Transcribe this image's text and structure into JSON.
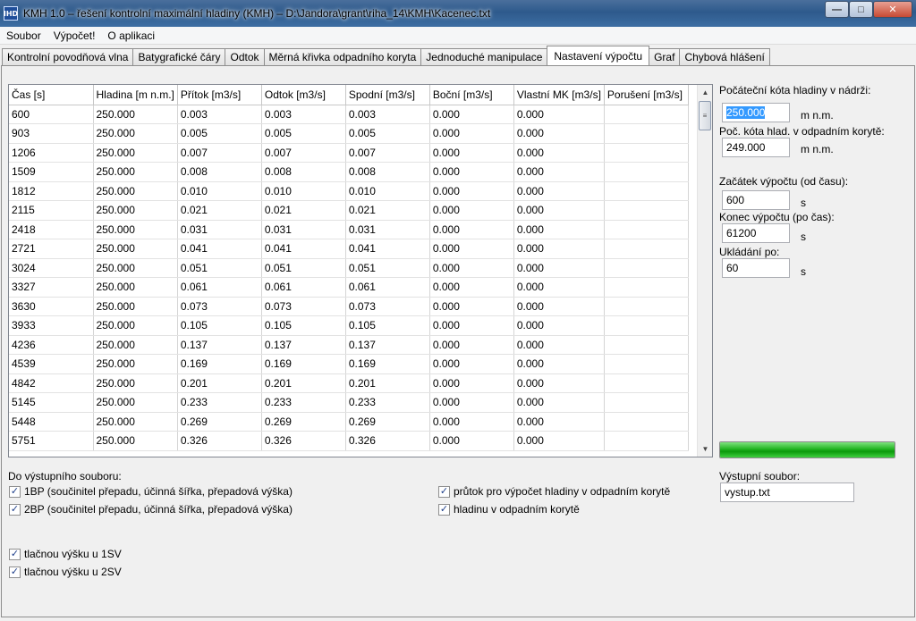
{
  "window": {
    "title": "KMH 1.0 – řešení kontrolní maximální hladiny (KMH) – D:\\Jandora\\grant\\riha_14\\KMH\\Kacenec.txt",
    "app_icon_text": "IHD"
  },
  "menu": [
    "Soubor",
    "Výpočet!",
    "O aplikaci"
  ],
  "tabs": [
    {
      "label": "Kontrolní povodňová vlna",
      "active": false
    },
    {
      "label": "Batygrafické čáry",
      "active": false
    },
    {
      "label": "Odtok",
      "active": false
    },
    {
      "label": "Měrná křivka odpadního koryta",
      "active": false
    },
    {
      "label": "Jednoduché manipulace",
      "active": false
    },
    {
      "label": "Nastavení výpočtu",
      "active": true
    },
    {
      "label": "Graf",
      "active": false
    },
    {
      "label": "Chybová hlášení",
      "active": false
    }
  ],
  "grid": {
    "columns": [
      "Čas [s]",
      "Hladina [m n.m.]",
      "Přítok [m3/s]",
      "Odtok [m3/s]",
      "Spodní [m3/s]",
      "Boční [m3/s]",
      "Vlastní MK [m3/s]",
      "Porušení [m3/s]"
    ],
    "rows": [
      [
        "600",
        "250.000",
        "0.003",
        "0.003",
        "0.003",
        "0.000",
        "0.000",
        ""
      ],
      [
        "903",
        "250.000",
        "0.005",
        "0.005",
        "0.005",
        "0.000",
        "0.000",
        ""
      ],
      [
        "1206",
        "250.000",
        "0.007",
        "0.007",
        "0.007",
        "0.000",
        "0.000",
        ""
      ],
      [
        "1509",
        "250.000",
        "0.008",
        "0.008",
        "0.008",
        "0.000",
        "0.000",
        ""
      ],
      [
        "1812",
        "250.000",
        "0.010",
        "0.010",
        "0.010",
        "0.000",
        "0.000",
        ""
      ],
      [
        "2115",
        "250.000",
        "0.021",
        "0.021",
        "0.021",
        "0.000",
        "0.000",
        ""
      ],
      [
        "2418",
        "250.000",
        "0.031",
        "0.031",
        "0.031",
        "0.000",
        "0.000",
        ""
      ],
      [
        "2721",
        "250.000",
        "0.041",
        "0.041",
        "0.041",
        "0.000",
        "0.000",
        ""
      ],
      [
        "3024",
        "250.000",
        "0.051",
        "0.051",
        "0.051",
        "0.000",
        "0.000",
        ""
      ],
      [
        "3327",
        "250.000",
        "0.061",
        "0.061",
        "0.061",
        "0.000",
        "0.000",
        ""
      ],
      [
        "3630",
        "250.000",
        "0.073",
        "0.073",
        "0.073",
        "0.000",
        "0.000",
        ""
      ],
      [
        "3933",
        "250.000",
        "0.105",
        "0.105",
        "0.105",
        "0.000",
        "0.000",
        ""
      ],
      [
        "4236",
        "250.000",
        "0.137",
        "0.137",
        "0.137",
        "0.000",
        "0.000",
        ""
      ],
      [
        "4539",
        "250.000",
        "0.169",
        "0.169",
        "0.169",
        "0.000",
        "0.000",
        ""
      ],
      [
        "4842",
        "250.000",
        "0.201",
        "0.201",
        "0.201",
        "0.000",
        "0.000",
        ""
      ],
      [
        "5145",
        "250.000",
        "0.233",
        "0.233",
        "0.233",
        "0.000",
        "0.000",
        ""
      ],
      [
        "5448",
        "250.000",
        "0.269",
        "0.269",
        "0.269",
        "0.000",
        "0.000",
        ""
      ],
      [
        "5751",
        "250.000",
        "0.326",
        "0.326",
        "0.326",
        "0.000",
        "0.000",
        ""
      ]
    ]
  },
  "settings": {
    "start_level_label": "Počáteční kóta hladiny v nádrži:",
    "start_level_value": "250.000",
    "start_level_unit": "m n.m.",
    "outflow_level_label": "Poč. kóta hlad. v odpadním korytě:",
    "outflow_level_value": "249.000",
    "outflow_level_unit": "m n.m.",
    "start_time_label": "Začátek výpočtu (od času):",
    "start_time_value": "600",
    "start_time_unit": "s",
    "end_time_label": "Konec výpočtu (po čas):",
    "end_time_value": "61200",
    "end_time_unit": "s",
    "save_label": "Ukládání po:",
    "save_value": "60",
    "save_unit": "s",
    "progress_fraction": 1.0,
    "output_file_label": "Výstupní soubor:",
    "output_file_value": "vystup.txt"
  },
  "output": {
    "heading": "Do výstupního souboru:",
    "cb_1bp": "1BP (součinitel přepadu, účinná šířka, přepadová výška)",
    "cb_2bp": "2BP (součinitel přepadu, účinná šířka, přepadová výška)",
    "cb_flow": "průtok pro výpočet hladiny v odpadním korytě",
    "cb_level": "hladinu v odpadním korytě",
    "cb_1sv": "tlačnou výšku u 1SV",
    "cb_2sv": "tlačnou výšku u 2SV",
    "check_mark": "✓"
  }
}
